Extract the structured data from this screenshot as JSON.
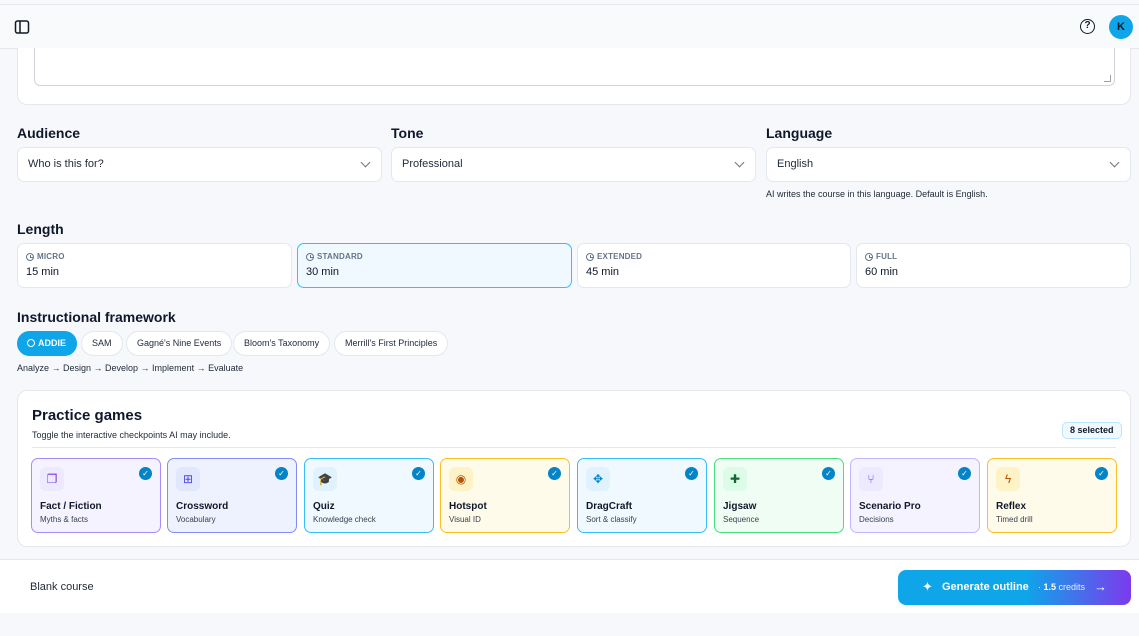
{
  "topbar": {
    "avatar_initial": "K",
    "help_symbol": "?"
  },
  "audience": {
    "label": "Audience",
    "value": "Who is this for?"
  },
  "tone": {
    "label": "Tone",
    "value": "Professional"
  },
  "language": {
    "label": "Language",
    "value": "English",
    "hint": "AI writes the course in this language. Default is English."
  },
  "length": {
    "label": "Length",
    "selected": "STANDARD",
    "options": [
      {
        "name": "MICRO",
        "value": "15 min"
      },
      {
        "name": "STANDARD",
        "value": "30 min"
      },
      {
        "name": "EXTENDED",
        "value": "45 min"
      },
      {
        "name": "FULL",
        "value": "60 min"
      }
    ]
  },
  "framework": {
    "label": "Instructional framework",
    "selected": "ADDIE",
    "options": [
      "ADDIE",
      "SAM",
      "Gagné's Nine Events",
      "Bloom's Taxonomy",
      "Merrill's First Principles"
    ],
    "description": "Analyze → Design → Develop → Implement → Evaluate"
  },
  "games": {
    "title": "Practice games",
    "subtitle": "Toggle the interactive checkpoints AI may include.",
    "badge": "8 selected",
    "items": [
      {
        "name": "Fact / Fiction",
        "desc": "Myths & facts",
        "icon": "cards-icon",
        "glyph": "❐",
        "border": "#a78bfa",
        "bg": "#f5f3ff",
        "icon_bg": "#ede9fe",
        "icon_color": "#7c3aed",
        "checked": true
      },
      {
        "name": "Crossword",
        "desc": "Vocabulary",
        "icon": "crossword-icon",
        "glyph": "⊞",
        "border": "#818cf8",
        "bg": "#eef2ff",
        "icon_bg": "#e0e7ff",
        "icon_color": "#4f46e5",
        "checked": true
      },
      {
        "name": "Quiz",
        "desc": "Knowledge check",
        "icon": "graduation-cap-icon",
        "glyph": "🎓",
        "border": "#38bdf8",
        "bg": "#f0f9ff",
        "icon_bg": "#e0f2fe",
        "icon_color": "#0284c7",
        "checked": true
      },
      {
        "name": "Hotspot",
        "desc": "Visual ID",
        "icon": "map-pin-icon",
        "glyph": "◉",
        "border": "#fbbf24",
        "bg": "#fffbeb",
        "icon_bg": "#fef3c7",
        "icon_color": "#b45309",
        "checked": true
      },
      {
        "name": "DragCraft",
        "desc": "Sort & classify",
        "icon": "move-icon",
        "glyph": "✥",
        "border": "#38bdf8",
        "bg": "#f0f9ff",
        "icon_bg": "#e0f2fe",
        "icon_color": "#0284c7",
        "checked": true
      },
      {
        "name": "Jigsaw",
        "desc": "Sequence",
        "icon": "puzzle-icon",
        "glyph": "✚",
        "border": "#4ade80",
        "bg": "#f0fdf4",
        "icon_bg": "#dcfce7",
        "icon_color": "#166534",
        "checked": true
      },
      {
        "name": "Scenario Pro",
        "desc": "Decisions",
        "icon": "branch-icon",
        "glyph": "⑂",
        "border": "#c4b5fd",
        "bg": "#f5f3ff",
        "icon_bg": "#ede9fe",
        "icon_color": "#7c3aed",
        "checked": true
      },
      {
        "name": "Reflex",
        "desc": "Timed drill",
        "icon": "lightning-icon",
        "glyph": "ϟ",
        "border": "#fbbf24",
        "bg": "#fffbeb",
        "icon_bg": "#fef3c7",
        "icon_color": "#b45309",
        "checked": true
      }
    ]
  },
  "footer": {
    "blank_label": "Blank course",
    "generate_label": "Generate outline",
    "credits_amount": "1.5",
    "credits_unit": "credits",
    "separator": "·"
  }
}
